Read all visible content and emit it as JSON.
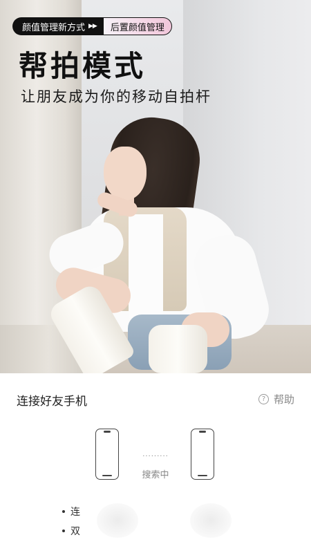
{
  "hero": {
    "tag": {
      "primary": "颜值管理新方式",
      "arrows": "▶▶",
      "secondary": "后置颜值管理"
    },
    "title": "帮拍模式",
    "subtitle": "让朋友成为你的移动自拍杆"
  },
  "panel": {
    "title": "连接好友手机",
    "help_label": "帮助",
    "help_icon": "?",
    "connection_dots": "·········",
    "status": "搜索中",
    "bullets": [
      "连",
      "双"
    ]
  }
}
